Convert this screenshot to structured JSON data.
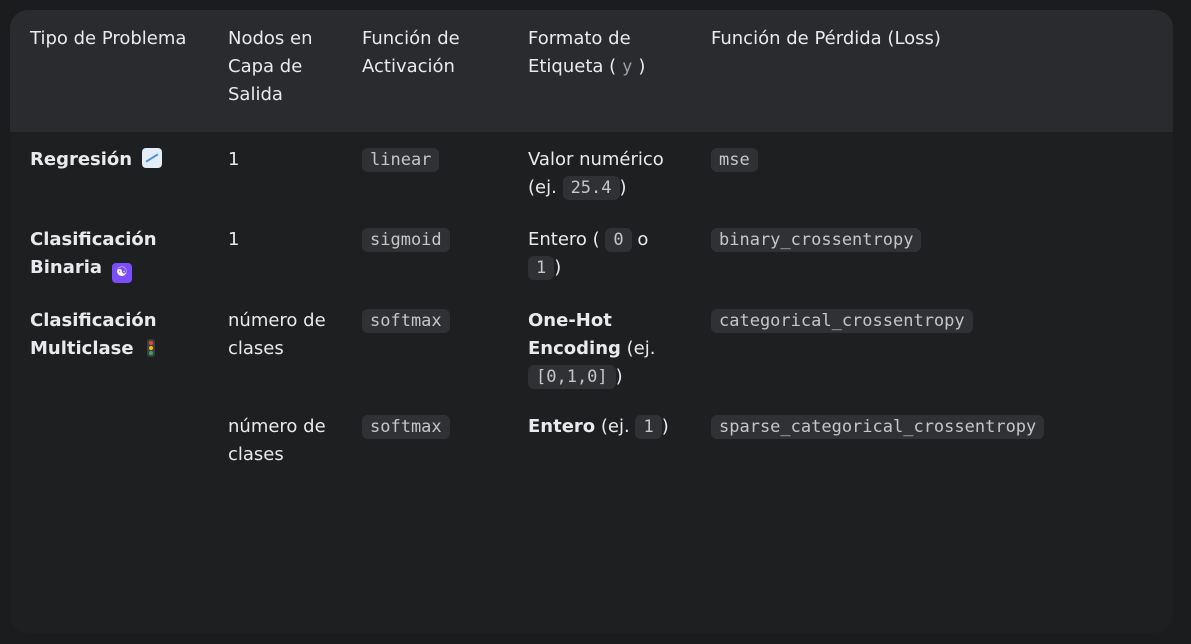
{
  "headers": {
    "tipo": "Tipo de Problema",
    "nodos": "Nodos en Capa de Salida",
    "activacion": "Función de Activación",
    "formato_pre": "Formato de Etiqueta (",
    "formato_code": "y",
    "formato_post": ")",
    "loss": "Función de Pérdida (Loss)"
  },
  "rows": [
    {
      "tipo": "Regresión",
      "icon": "chart-increasing-icon",
      "nodos": "1",
      "activacion": "linear",
      "formato_pre": "Valor numérico (ej.",
      "formato_code": "25.4",
      "formato_post": ")",
      "loss": "mse"
    },
    {
      "tipo": "Clasificación Binaria",
      "icon": "yin-yang-icon",
      "nodos": "1",
      "activacion": "sigmoid",
      "formato_pre": "Entero (",
      "formato_code_a": "0",
      "formato_mid": "o",
      "formato_code_b": "1",
      "formato_post": ")",
      "loss": "binary_crossentropy"
    },
    {
      "tipo": "Clasificación Multiclase",
      "icon": "traffic-light-icon",
      "nodos": "número de clases",
      "activacion": "softmax",
      "formato_bold": "One-Hot Encoding",
      "formato_pre": "(ej.",
      "formato_code": "[0,1,0]",
      "formato_post": ")",
      "loss": "categorical_crossentropy"
    },
    {
      "tipo": "",
      "nodos": "número de clases",
      "activacion": "softmax",
      "formato_bold": "Entero",
      "formato_pre": "(ej.",
      "formato_code": "1",
      "formato_post": ")",
      "loss": "sparse_categorical_crossentropy"
    }
  ]
}
